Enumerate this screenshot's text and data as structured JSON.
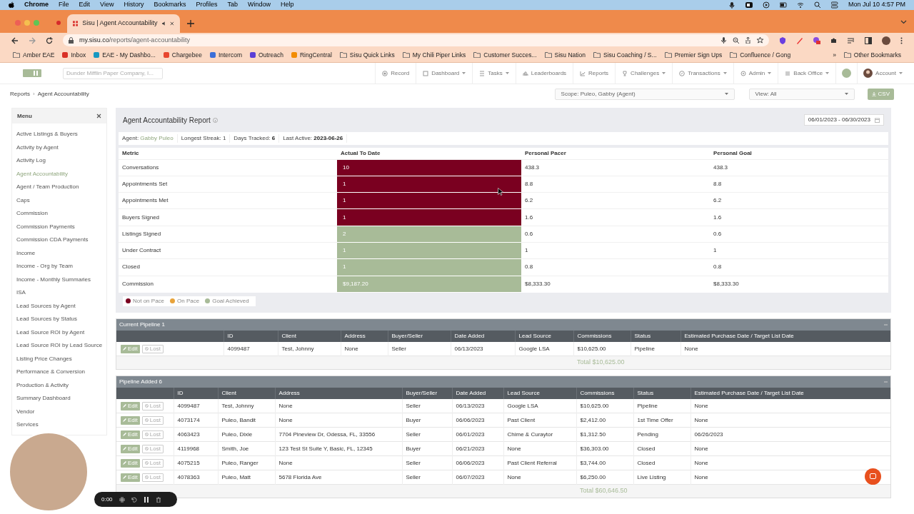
{
  "mac_menu": {
    "app": "Chrome",
    "items": [
      "File",
      "Edit",
      "View",
      "History",
      "Bookmarks",
      "Profiles",
      "Tab",
      "Window",
      "Help"
    ],
    "clock": "Mon Jul 10  4:57 PM"
  },
  "browser": {
    "tab_title": "Sisu | Agent Accountability",
    "url_host": "my.sisu.co",
    "url_path": "/reports/agent-accountability",
    "bookmarks": [
      {
        "label": "Amber EAE",
        "kind": "folder"
      },
      {
        "label": "Inbox",
        "kind": "site",
        "color": "#d93025"
      },
      {
        "label": "EAE - My Dashbo...",
        "kind": "site",
        "color": "#1798c1"
      },
      {
        "label": "Chargebee",
        "kind": "site",
        "color": "#e8462e"
      },
      {
        "label": "Intercom",
        "kind": "site",
        "color": "#3b6fd8"
      },
      {
        "label": "Outreach",
        "kind": "site",
        "color": "#5b3fd6"
      },
      {
        "label": "RingCentral",
        "kind": "site",
        "color": "#f28c00"
      },
      {
        "label": "Sisu Quick Links",
        "kind": "folder"
      },
      {
        "label": "My Chili Piper Links",
        "kind": "folder"
      },
      {
        "label": "Customer Succes...",
        "kind": "folder"
      },
      {
        "label": "Sisu Nation",
        "kind": "folder"
      },
      {
        "label": "Sisu Coaching / S...",
        "kind": "folder"
      },
      {
        "label": "Premier Sign Ups",
        "kind": "folder"
      },
      {
        "label": "Confluence / Gong",
        "kind": "folder"
      }
    ],
    "more": "»",
    "other_bookmarks": "Other Bookmarks"
  },
  "app_nav": {
    "org_select": "Dunder Mifflin Paper Company, I...",
    "items": [
      {
        "label": "Record",
        "dropdown": false
      },
      {
        "label": "Dashboard",
        "dropdown": true
      },
      {
        "label": "Tasks",
        "dropdown": true
      },
      {
        "label": "Leaderboards",
        "dropdown": false
      },
      {
        "label": "Reports",
        "dropdown": false
      },
      {
        "label": "Challenges",
        "dropdown": true
      },
      {
        "label": "Transactions",
        "dropdown": true
      },
      {
        "label": "Admin",
        "dropdown": true
      },
      {
        "label": "Back Office",
        "dropdown": true
      }
    ],
    "account": "Account"
  },
  "breadcrumb": {
    "items": [
      "Reports",
      "Agent Accountability"
    ],
    "separator": "›"
  },
  "scope_select": "Scope: Puleo, Gabby (Agent)",
  "view_select": "View: All",
  "csv_button": "CSV",
  "sidebar": {
    "title": "Menu",
    "items": [
      {
        "label": "Active Listings & Buyers",
        "selected": false
      },
      {
        "label": "Activity by Agent",
        "selected": false
      },
      {
        "label": "Activity Log",
        "selected": false
      },
      {
        "label": "Agent Accountability",
        "selected": true
      },
      {
        "label": "Agent / Team Production",
        "selected": false
      },
      {
        "label": "Caps",
        "selected": false
      },
      {
        "label": "Commission",
        "selected": false
      },
      {
        "label": "Commission Payments",
        "selected": false
      },
      {
        "label": "Commission CDA Payments",
        "selected": false
      },
      {
        "label": "Income",
        "selected": false
      },
      {
        "label": "Income - Org by Team",
        "selected": false
      },
      {
        "label": "Income - Monthly Summaries",
        "selected": false
      },
      {
        "label": "ISA",
        "selected": false
      },
      {
        "label": "Lead Sources by Agent",
        "selected": false
      },
      {
        "label": "Lead Sources by Status",
        "selected": false
      },
      {
        "label": "Lead Source ROI by Agent",
        "selected": false
      },
      {
        "label": "Lead Source ROI by Lead Source",
        "selected": false
      },
      {
        "label": "Listing Price Changes",
        "selected": false
      },
      {
        "label": "Performance & Conversion",
        "selected": false
      },
      {
        "label": "Production & Activity",
        "selected": false
      },
      {
        "label": "Summary Dashboard",
        "selected": false
      },
      {
        "label": "Vendor",
        "selected": false
      },
      {
        "label": "Services",
        "selected": false
      }
    ]
  },
  "report": {
    "title": "Agent Accountability Report",
    "date_range": "06/01/2023 - 06/30/2023",
    "info": [
      {
        "label": "Agent:",
        "value": "Gabby Puleo",
        "kind": "link"
      },
      {
        "label": "Longest Streak:",
        "value": "1",
        "kind": "plain"
      },
      {
        "label": "Days Tracked:",
        "value": "6",
        "kind": "bold"
      },
      {
        "label": "Last Active:",
        "value": "2023-06-26",
        "kind": "bold"
      }
    ],
    "columns": [
      "Metric",
      "Actual To Date",
      "Personal Pacer",
      "Personal Goal"
    ],
    "rows": [
      {
        "metric": "Conversations",
        "actual": "10",
        "pacer": "438.3",
        "goal": "438.3",
        "color": "#7a0020"
      },
      {
        "metric": "Appointments Set",
        "actual": "1",
        "pacer": "8.8",
        "goal": "8.8",
        "color": "#7a0020"
      },
      {
        "metric": "Appointments Met",
        "actual": "1",
        "pacer": "6.2",
        "goal": "6.2",
        "color": "#7a0020"
      },
      {
        "metric": "Buyers Signed",
        "actual": "1",
        "pacer": "1.6",
        "goal": "1.6",
        "color": "#7a0020"
      },
      {
        "metric": "Listings Signed",
        "actual": "2",
        "pacer": "0.6",
        "goal": "0.6",
        "color": "#a8bb98"
      },
      {
        "metric": "Under Contract",
        "actual": "1",
        "pacer": "1",
        "goal": "1",
        "color": "#a8bb98"
      },
      {
        "metric": "Closed",
        "actual": "1",
        "pacer": "0.8",
        "goal": "0.8",
        "color": "#a8bb98"
      },
      {
        "metric": "Commission",
        "actual": "$9,187.20",
        "pacer": "$8,333.30",
        "goal": "$8,333.30",
        "color": "#a8bb98"
      }
    ],
    "legend": [
      {
        "label": "Not on Pace",
        "color": "#7a0020"
      },
      {
        "label": "On Pace",
        "color": "#e8a33a"
      },
      {
        "label": "Goal Achieved",
        "color": "#a8bb98"
      }
    ]
  },
  "pipelines": [
    {
      "title": "Current Pipeline 1",
      "columns": [
        "ID",
        "Client",
        "Address",
        "Buyer/Seller",
        "Date Added",
        "Lead Source",
        "Commissions",
        "Status",
        "Estimated Purchase Date / Target List Date"
      ],
      "rows": [
        {
          "edit": "Edit",
          "lost": "Lost",
          "cells": [
            "4099487",
            "Test, Johnny",
            "None",
            "Seller",
            "06/13/2023",
            "Google LSA",
            "$10,625.00",
            "Pipeline",
            "None"
          ]
        }
      ],
      "total": "Total $10,625.00"
    },
    {
      "title": "Pipeline Added 6",
      "columns": [
        "ID",
        "Client",
        "Address",
        "Buyer/Seller",
        "Date Added",
        "Lead Source",
        "Commissions",
        "Status",
        "Estimated Purchase Date / Target List Date"
      ],
      "rows": [
        {
          "edit": "Edit",
          "lost": "Lost",
          "cells": [
            "4099487",
            "Test, Johnny",
            "None",
            "Seller",
            "06/13/2023",
            "Google LSA",
            "$10,625.00",
            "Pipeline",
            "None"
          ]
        },
        {
          "edit": "Edit",
          "lost": "Lost",
          "cells": [
            "4073174",
            "Puleo, Bandit",
            "None",
            "Buyer",
            "06/06/2023",
            "Past Client",
            "$2,412.00",
            "1st Time Offer",
            "None"
          ]
        },
        {
          "edit": "Edit",
          "lost": "Lost",
          "cells": [
            "4063423",
            "Puleo, Dixie",
            "7704 Pineview Dr, Odessa, FL, 33556",
            "Seller",
            "06/01/2023",
            "Chime & Curaytor",
            "$1,312.50",
            "Pending",
            "06/26/2023"
          ]
        },
        {
          "edit": "Edit",
          "lost": "Lost",
          "cells": [
            "4119968",
            "Smith, Joe",
            "123 Test St Suite Y, Basic, FL, 12345",
            "Buyer",
            "06/21/2023",
            "None",
            "$36,303.00",
            "Closed",
            "None"
          ]
        },
        {
          "edit": "Edit",
          "lost": "Lost",
          "cells": [
            "4075215",
            "Puleo, Ranger",
            "None",
            "Seller",
            "06/06/2023",
            "Past Client Referral",
            "$3,744.00",
            "Closed",
            "None"
          ]
        },
        {
          "edit": "Edit",
          "lost": "Lost",
          "cells": [
            "4078363",
            "Puleo, Matt",
            "5678 Florida Ave",
            "Seller",
            "06/07/2023",
            "None",
            "$6,250.00",
            "Live Listing",
            "None"
          ]
        }
      ],
      "total": "Total $60,646.50"
    }
  ],
  "recorder": {
    "time": "0:00"
  }
}
